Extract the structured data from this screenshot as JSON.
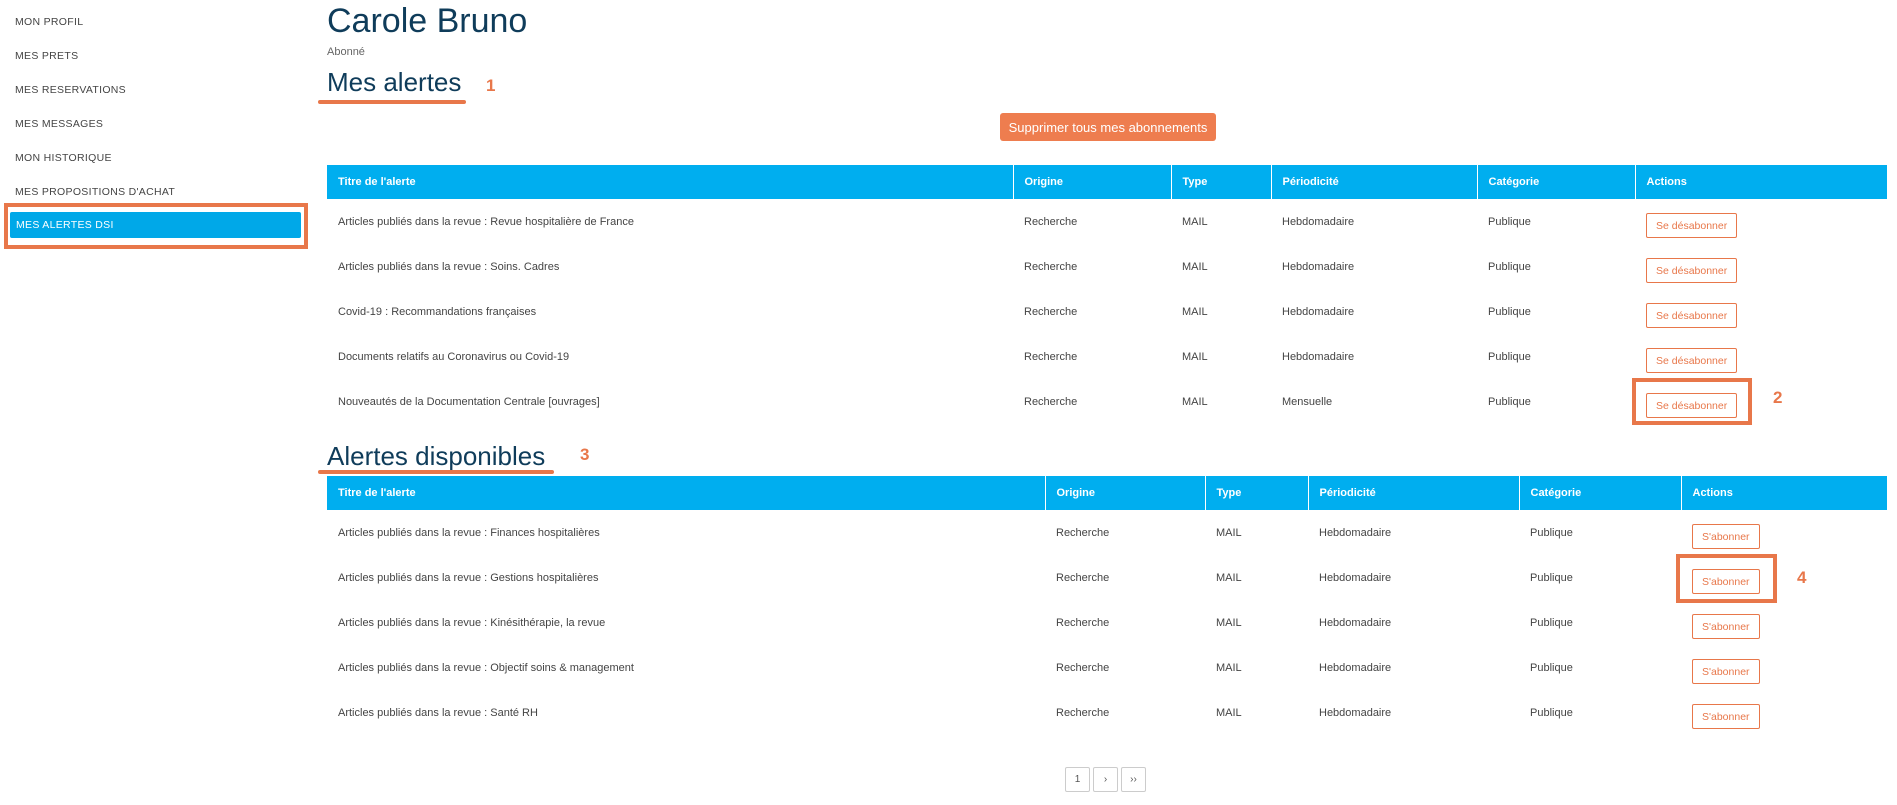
{
  "sidebar": {
    "items": [
      {
        "label": "MON PROFIL"
      },
      {
        "label": "MES PRETS"
      },
      {
        "label": "MES RESERVATIONS"
      },
      {
        "label": "MES MESSAGES"
      },
      {
        "label": "MON HISTORIQUE"
      },
      {
        "label": "MES PROPOSITIONS D'ACHAT"
      },
      {
        "label": "MES ALERTES DSI",
        "active": true
      }
    ]
  },
  "header": {
    "name": "Carole Bruno",
    "status": "Abonné"
  },
  "my_alerts": {
    "title": "Mes alertes",
    "annotation": "1",
    "delete_all_label": "Supprimer tous mes abonnements",
    "columns": [
      "Titre de l'alerte",
      "Origine",
      "Type",
      "Périodicité",
      "Catégorie",
      "Actions"
    ],
    "rows": [
      {
        "title": "Articles publiés dans la revue : Revue hospitalière de France",
        "origin": "Recherche",
        "type": "MAIL",
        "period": "Hebdomadaire",
        "category": "Publique",
        "action": "Se désabonner"
      },
      {
        "title": "Articles publiés dans la revue : Soins. Cadres",
        "origin": "Recherche",
        "type": "MAIL",
        "period": "Hebdomadaire",
        "category": "Publique",
        "action": "Se désabonner"
      },
      {
        "title": "Covid-19 : Recommandations françaises",
        "origin": "Recherche",
        "type": "MAIL",
        "period": "Hebdomadaire",
        "category": "Publique",
        "action": "Se désabonner"
      },
      {
        "title": "Documents relatifs au Coronavirus ou Covid-19",
        "origin": "Recherche",
        "type": "MAIL",
        "period": "Hebdomadaire",
        "category": "Publique",
        "action": "Se désabonner"
      },
      {
        "title": "Nouveautés de la Documentation Centrale [ouvrages]",
        "origin": "Recherche",
        "type": "MAIL",
        "period": "Mensuelle",
        "category": "Publique",
        "action": "Se désabonner"
      }
    ],
    "row_annotation": "2"
  },
  "available_alerts": {
    "title": "Alertes disponibles",
    "annotation": "3",
    "columns": [
      "Titre de l'alerte",
      "Origine",
      "Type",
      "Périodicité",
      "Catégorie",
      "Actions"
    ],
    "rows": [
      {
        "title": "Articles publiés dans la revue : Finances hospitalières",
        "origin": "Recherche",
        "type": "MAIL",
        "period": "Hebdomadaire",
        "category": "Publique",
        "action": "S'abonner"
      },
      {
        "title": "Articles publiés dans la revue : Gestions hospitalières",
        "origin": "Recherche",
        "type": "MAIL",
        "period": "Hebdomadaire",
        "category": "Publique",
        "action": "S'abonner"
      },
      {
        "title": "Articles publiés dans la revue : Kinésithérapie, la revue",
        "origin": "Recherche",
        "type": "MAIL",
        "period": "Hebdomadaire",
        "category": "Publique",
        "action": "S'abonner"
      },
      {
        "title": "Articles publiés dans la revue : Objectif soins & management",
        "origin": "Recherche",
        "type": "MAIL",
        "period": "Hebdomadaire",
        "category": "Publique",
        "action": "S'abonner"
      },
      {
        "title": "Articles publiés dans la revue : Santé RH",
        "origin": "Recherche",
        "type": "MAIL",
        "period": "Hebdomadaire",
        "category": "Publique",
        "action": "S'abonner"
      }
    ],
    "row_annotation": "4"
  },
  "pagination": {
    "page": "1",
    "next": "›",
    "last": "››"
  },
  "colors": {
    "accent": "#00aeef",
    "annotation": "#e8774a",
    "title": "#0f3c5a"
  }
}
